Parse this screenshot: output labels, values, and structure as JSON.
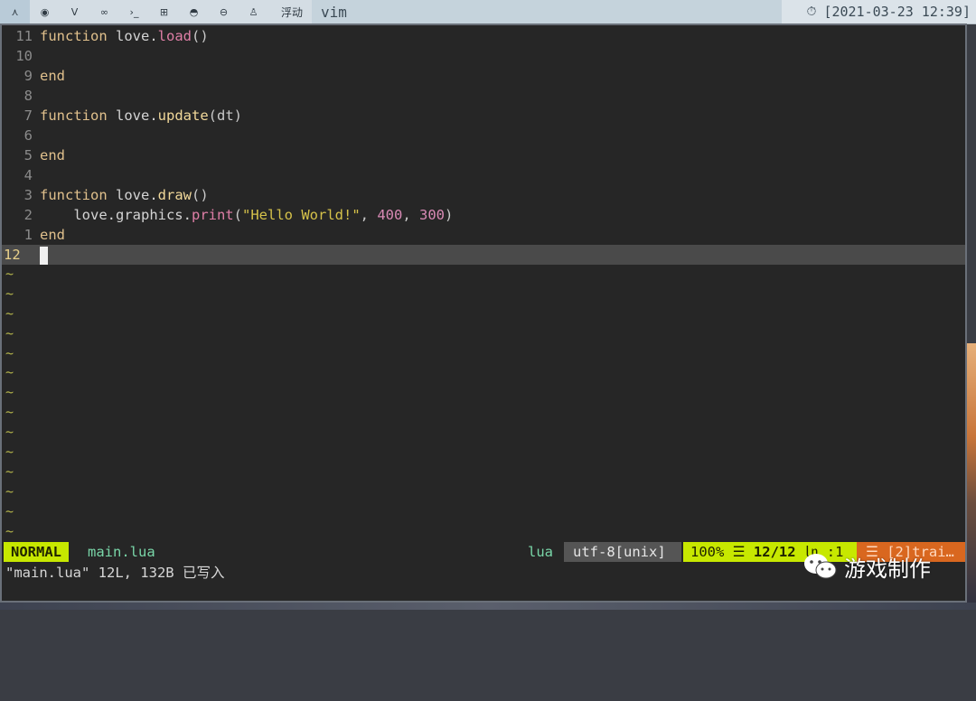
{
  "topbar": {
    "buttons": [
      {
        "icon": "menu-icon",
        "glyph": "⋏"
      },
      {
        "icon": "chrome-icon",
        "glyph": "◉"
      },
      {
        "icon": "vim-icon",
        "glyph": "V"
      },
      {
        "icon": "infinity-icon",
        "glyph": "∞"
      },
      {
        "icon": "terminal-icon",
        "glyph": "›_"
      },
      {
        "icon": "windows-icon",
        "glyph": "⊞"
      },
      {
        "icon": "android-icon",
        "glyph": "◓"
      },
      {
        "icon": "disc-icon",
        "glyph": "⊖"
      },
      {
        "icon": "linux-penguin-icon",
        "glyph": "♙"
      }
    ],
    "floating_label": "浮动",
    "window_title": "vim",
    "clock_icon": "stopwatch-icon",
    "clock": "[2021-03-23 12:39]"
  },
  "editor": {
    "lines": [
      {
        "num": "11",
        "tokens": [
          [
            "kw",
            "function"
          ],
          [
            "punc",
            " "
          ],
          [
            "fn",
            "love."
          ],
          [
            "call",
            "load"
          ],
          [
            "punc",
            "()"
          ]
        ]
      },
      {
        "num": "10",
        "tokens": []
      },
      {
        "num": "9",
        "tokens": [
          [
            "kw",
            "end"
          ]
        ]
      },
      {
        "num": "8",
        "tokens": []
      },
      {
        "num": "7",
        "tokens": [
          [
            "kw",
            "function"
          ],
          [
            "punc",
            " "
          ],
          [
            "fn",
            "love."
          ],
          [
            "fnname",
            "update"
          ],
          [
            "punc",
            "(dt)"
          ]
        ]
      },
      {
        "num": "6",
        "tokens": []
      },
      {
        "num": "5",
        "tokens": [
          [
            "kw",
            "end"
          ]
        ]
      },
      {
        "num": "4",
        "tokens": []
      },
      {
        "num": "3",
        "tokens": [
          [
            "kw",
            "function"
          ],
          [
            "punc",
            " "
          ],
          [
            "fn",
            "love."
          ],
          [
            "fnname",
            "draw"
          ],
          [
            "punc",
            "()"
          ]
        ]
      },
      {
        "num": "2",
        "tokens": [
          [
            "punc",
            "    "
          ],
          [
            "fn",
            "love.graphics."
          ],
          [
            "call",
            "print"
          ],
          [
            "punc",
            "("
          ],
          [
            "str",
            "\"Hello World!\""
          ],
          [
            "punc",
            ", "
          ],
          [
            "num",
            "400"
          ],
          [
            "punc",
            ", "
          ],
          [
            "num",
            "300"
          ],
          [
            "punc",
            ")"
          ]
        ]
      },
      {
        "num": "1",
        "tokens": [
          [
            "kw",
            "end"
          ]
        ]
      },
      {
        "num": "12",
        "tokens": [],
        "current": true
      }
    ],
    "tilde": "~",
    "tilde_count": 14
  },
  "statusline": {
    "mode": "NORMAL",
    "file": "main.lua",
    "filetype": "lua",
    "encoding": "utf-8[unix]",
    "percent": "100%",
    "lines_icon": "☰",
    "position": "12/12",
    "column": "㏑ :1",
    "warnings": "☰ [2]trai…"
  },
  "message": "\"main.lua\" 12L, 132B 已写入",
  "watermark": {
    "icon": "wechat-icon",
    "text": "游戏制作"
  },
  "colors": {
    "mode_bg": "#c7e800",
    "warn_bg": "#d9671f",
    "editor_bg": "#262626"
  }
}
